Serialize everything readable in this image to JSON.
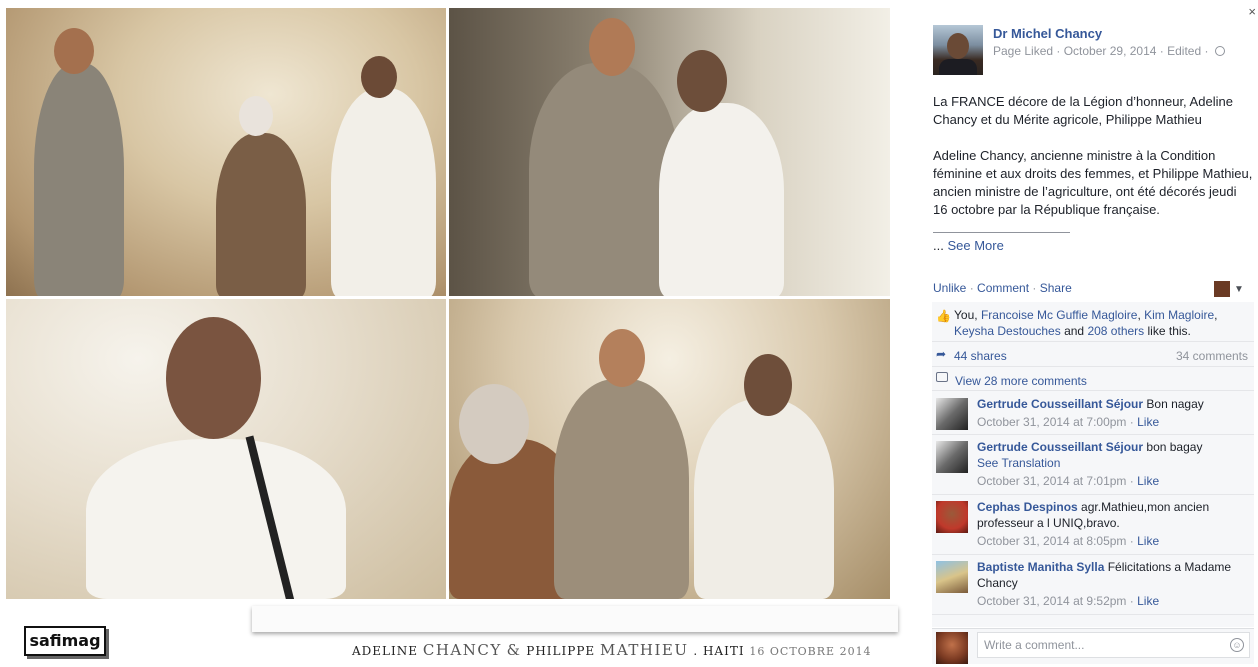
{
  "photo_collage": {
    "caption": {
      "word1": "ADELINE",
      "name1": "CHANCY",
      "amp": "&",
      "word2": "PHILIPPE",
      "name2": "MATHIEU",
      "sep": ". HAITI",
      "date": "16 OCTOBRE 2014"
    },
    "logo_text": "safimag"
  },
  "post": {
    "page_name": "Dr Michel Chancy",
    "meta": "Page Liked · October 29, 2014 · Edited ·",
    "paragraph1": "La FRANCE décore de la Légion d’honneur, Adeline Chancy et du Mérite agricole, Philippe Mathieu",
    "paragraph2": "Adeline Chancy, ancienne ministre à la Condition féminine et aux droits des femmes, et Philippe Mathieu, ancien ministre de l’agriculture, ont été décorés jeudi 16 octobre par la République française.",
    "see_more_prefix": "...",
    "see_more": "See More"
  },
  "actions": {
    "unlike": "Unlike",
    "dot": "·",
    "comment": "Comment",
    "share": "Share"
  },
  "likes": {
    "you": "You,",
    "name1": "Francoise Mc Guffie Magloire",
    "comma": ",",
    "name2": "Kim Magloire",
    "name3": "Keysha Destouches",
    "and": "and",
    "others": "208 others",
    "suffix": "like this."
  },
  "shares": "44 shares",
  "comments_count": "34 comments",
  "view_more": "View 28 more comments",
  "comments": [
    {
      "author": "Gertrude Cousseillant Séjour",
      "text": "Bon nagay",
      "extra": "",
      "time": "October 31, 2014 at 7:00pm",
      "like": "Like"
    },
    {
      "author": "Gertrude Cousseillant Séjour",
      "text": "bon bagay",
      "extra": "See Translation",
      "time": "October 31, 2014 at 7:01pm",
      "like": "Like"
    },
    {
      "author": "Cephas Despinos",
      "text": "agr.Mathieu,mon ancien professeur a l UNIQ,bravo.",
      "extra": "",
      "time": "October 31, 2014 at 8:05pm",
      "like": "Like"
    },
    {
      "author": "Baptiste Manitha Sylla",
      "text": "Félicitations a Madame Chancy",
      "extra": "",
      "time": "October 31, 2014 at 9:52pm",
      "like": "Like"
    }
  ],
  "composer": {
    "placeholder": "Write a comment..."
  },
  "icons": {
    "close": "×",
    "caret": "▼",
    "like": "👍",
    "share": "➦",
    "emoji": "☺"
  },
  "colors": {
    "link": "#365899",
    "meta": "#90949c",
    "ufi_bg": "#f6f7f9"
  }
}
